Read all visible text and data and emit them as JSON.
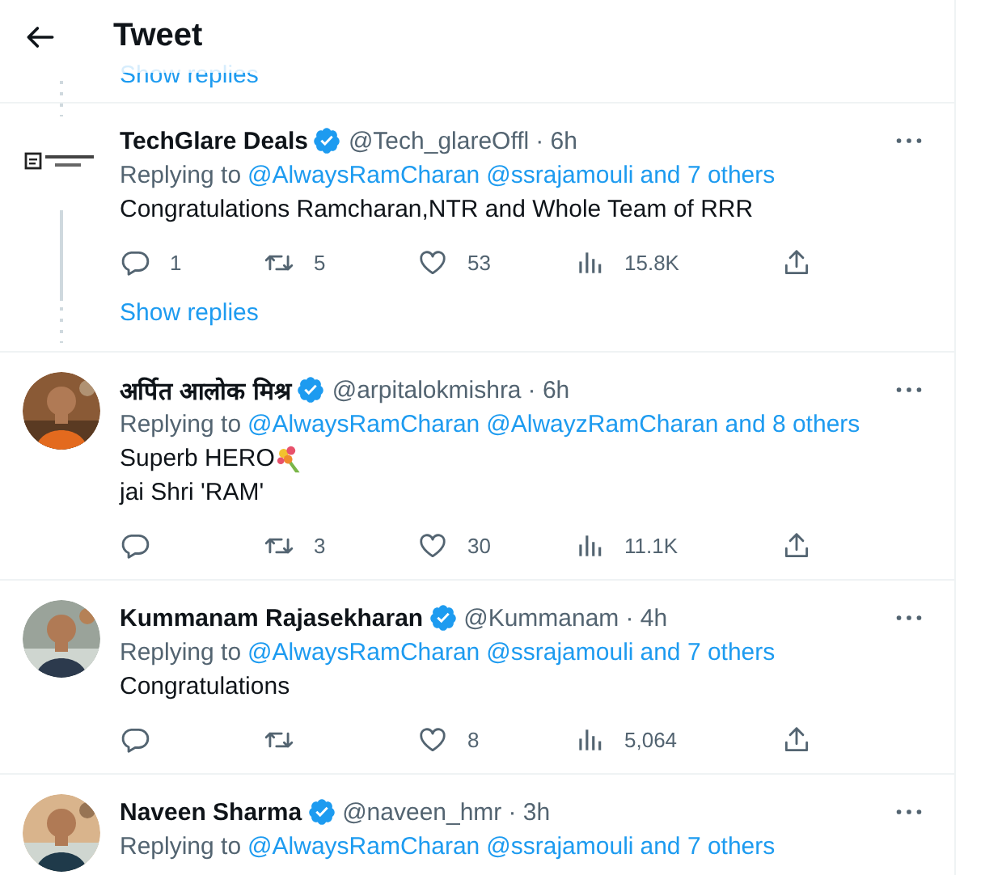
{
  "header": {
    "title": "Tweet"
  },
  "top_show_replies": "Show replies",
  "tweets": [
    {
      "avatar": {
        "kind": "logo"
      },
      "name": "TechGlare Deals",
      "verified": true,
      "handle": "@Tech_glareOffl",
      "time": "· 6h",
      "replying_prefix": "Replying to",
      "mentions": [
        "@AlwaysRamCharan",
        "@ssrajamouli",
        "and 7 others"
      ],
      "lines": [
        {
          "text": "Congratulations Ramcharan,NTR and Whole Team of RRR",
          "bouquet": false
        }
      ],
      "replies": "1",
      "retweets": "5",
      "likes": "53",
      "views": "15.8K",
      "thread": true,
      "show_replies": "Show replies"
    },
    {
      "avatar": {
        "kind": "picture"
      },
      "name": "अर्पित आलोक मिश्र",
      "verified": true,
      "handle": "@arpitalokmishra",
      "time": "· 6h",
      "replying_prefix": "Replying to",
      "mentions": [
        "@AlwaysRamCharan",
        "@AlwayzRamCharan",
        "and 8 others"
      ],
      "lines": [
        {
          "text": "Superb HERO",
          "bouquet": true
        },
        {
          "text": "jai Shri 'RAM'",
          "bouquet": false
        }
      ],
      "retweets": "3",
      "likes": "30",
      "views": "11.1K",
      "thread": false
    },
    {
      "avatar": {
        "kind": "picture"
      },
      "name": "Kummanam Rajasekharan",
      "verified": true,
      "handle": "@Kummanam",
      "time": "· 4h",
      "replying_prefix": "Replying to",
      "mentions": [
        "@AlwaysRamCharan",
        "@ssrajamouli",
        "and 7 others"
      ],
      "lines": [
        {
          "text": "Congratulations",
          "bouquet": false
        }
      ],
      "likes": "8",
      "views": "5,064",
      "thread": false
    },
    {
      "avatar": {
        "kind": "picture"
      },
      "name": "Naveen Sharma",
      "verified": true,
      "handle": "@naveen_hmr",
      "time": "· 3h",
      "replying_prefix": "Replying to",
      "mentions": [
        "@AlwaysRamCharan",
        "@ssrajamouli",
        "and 7 others"
      ],
      "thread": false,
      "cut": true
    }
  ]
}
